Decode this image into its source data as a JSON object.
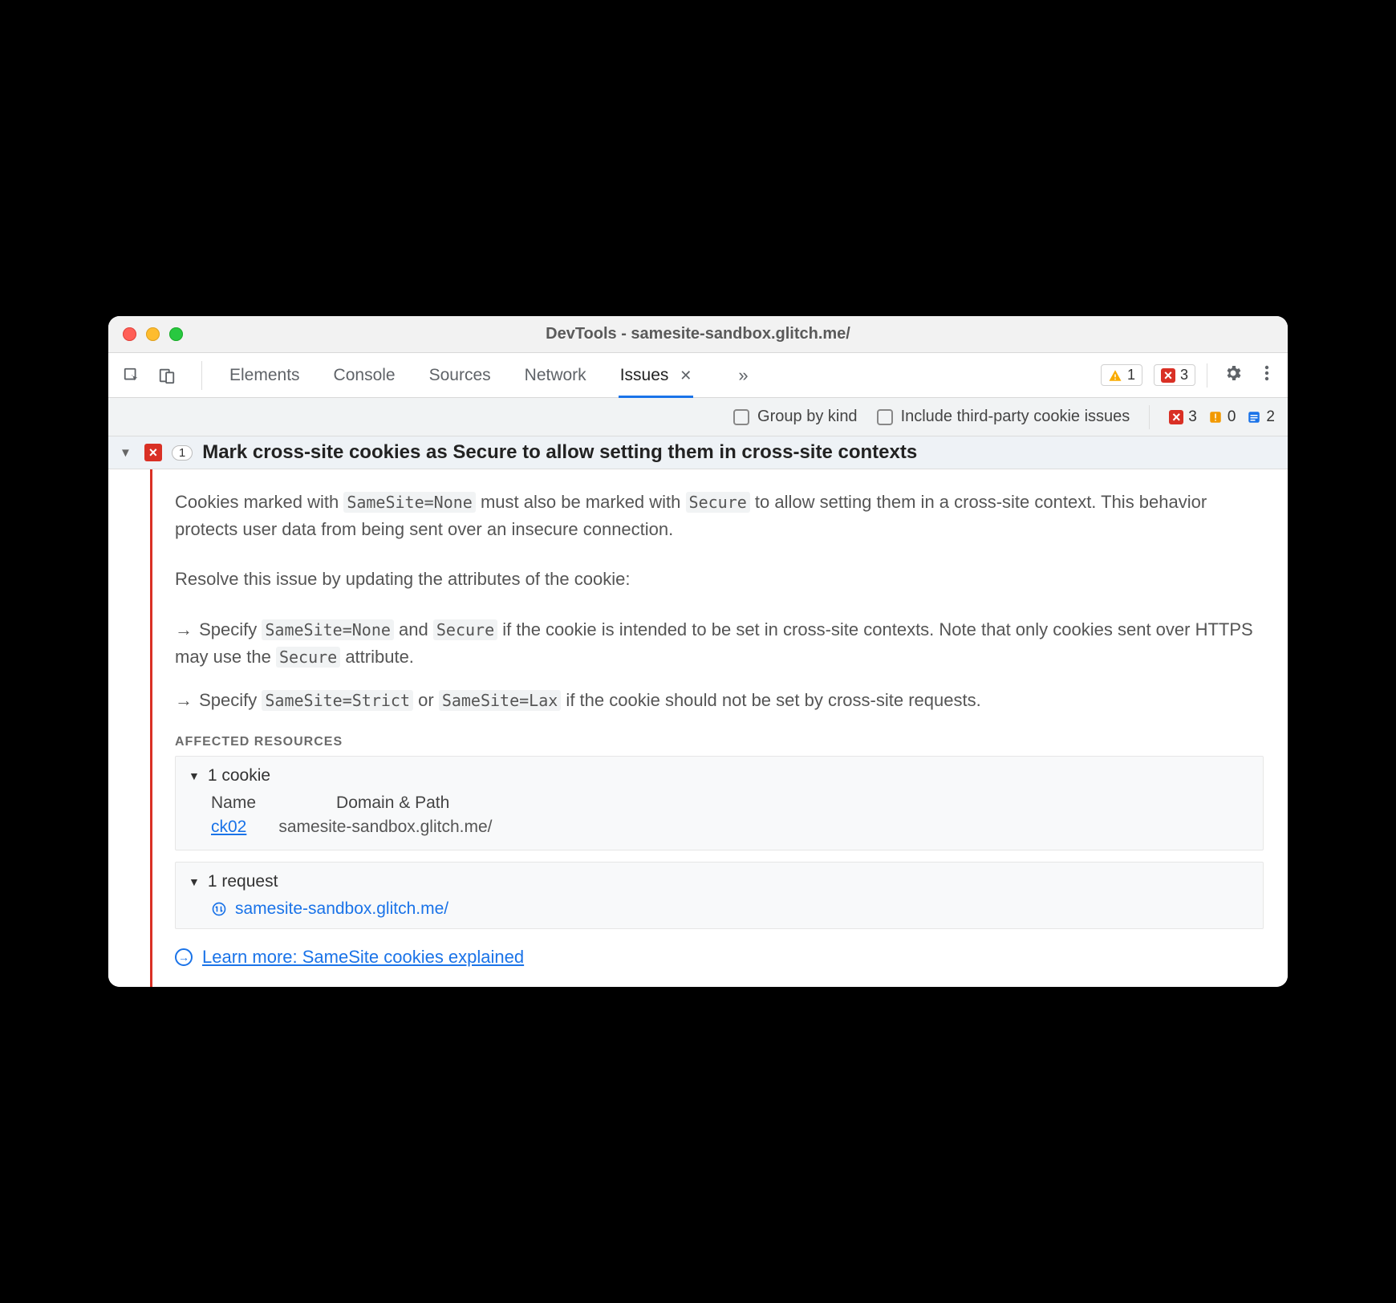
{
  "window": {
    "title": "DevTools - samesite-sandbox.glitch.me/"
  },
  "tabs": {
    "items": [
      "Elements",
      "Console",
      "Sources",
      "Network",
      "Issues"
    ],
    "active": "Issues",
    "overflow_glyph": "»"
  },
  "toolbar": {
    "warning_count": "1",
    "error_count": "3"
  },
  "options": {
    "group_by_kind": "Group by kind",
    "include_third_party": "Include third-party cookie issues",
    "bar_errors": "3",
    "bar_warnings": "0",
    "bar_info": "2"
  },
  "issue": {
    "count": "1",
    "title": "Mark cross-site cookies as Secure to allow setting them in cross-site contexts",
    "p1_a": "Cookies marked with ",
    "code1": "SameSite=None",
    "p1_b": " must also be marked with ",
    "code2": "Secure",
    "p1_c": " to allow setting them in a cross-site context. This behavior protects user data from being sent over an insecure connection.",
    "p2": "Resolve this issue by updating the attributes of the cookie:",
    "b1_a": "Specify ",
    "b1_c1": "SameSite=None",
    "b1_b": " and ",
    "b1_c2": "Secure",
    "b1_c": " if the cookie is intended to be set in cross-site contexts. Note that only cookies sent over HTTPS may use the ",
    "b1_c3": "Secure",
    "b1_d": " attribute.",
    "b2_a": "Specify ",
    "b2_c1": "SameSite=Strict",
    "b2_b": " or ",
    "b2_c2": "SameSite=Lax",
    "b2_c": " if the cookie should not be set by cross-site requests.",
    "affected_label": "AFFECTED RESOURCES",
    "cookie_header": "1 cookie",
    "cookie_cols": {
      "name": "Name",
      "domain": "Domain & Path"
    },
    "cookie_row": {
      "name": "ck02",
      "domain": "samesite-sandbox.glitch.me/"
    },
    "request_header": "1 request",
    "request_url": "samesite-sandbox.glitch.me/",
    "learn_more": "Learn more: SameSite cookies explained"
  }
}
